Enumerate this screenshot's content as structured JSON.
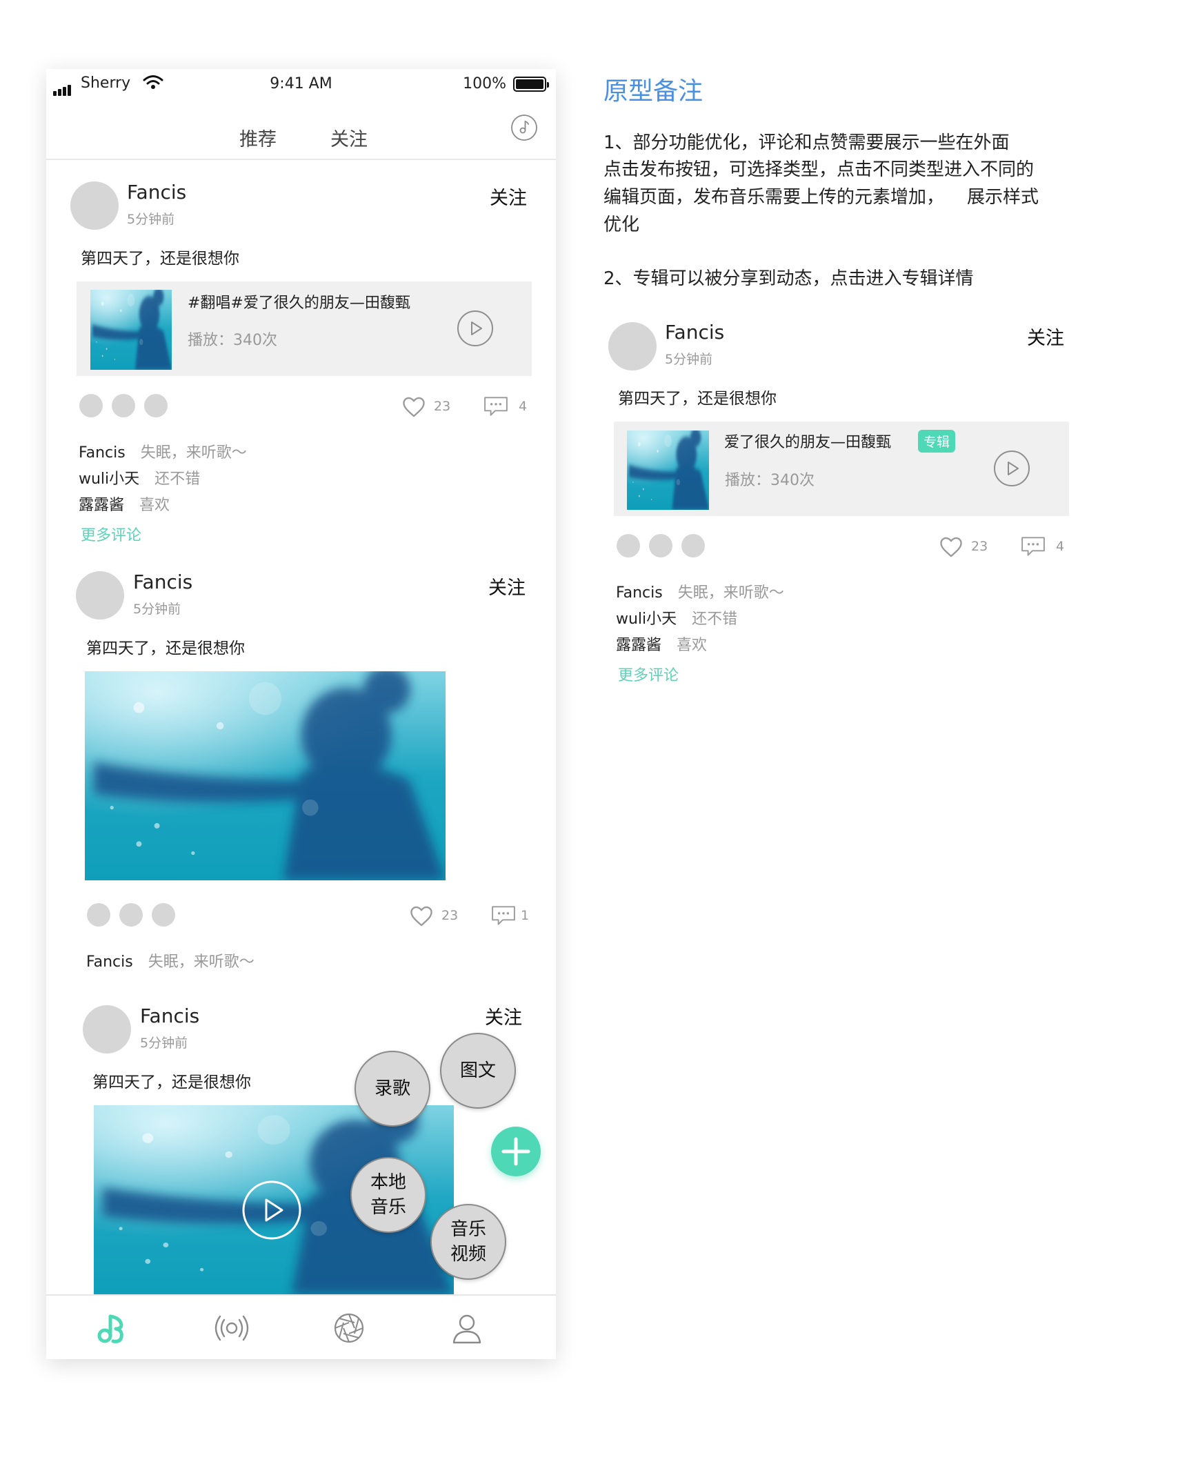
{
  "status_bar": {
    "carrier": "Sherry",
    "time": "9:41 AM",
    "battery": "100%"
  },
  "top_nav": {
    "tabs": [
      "推荐",
      "关注"
    ],
    "music_icon": "music-disc-icon"
  },
  "posts": [
    {
      "user": "Fancis",
      "time": "5分钟前",
      "follow": "关注",
      "text": "第四天了，还是很想你",
      "music": {
        "title": "#翻唱#爱了很久的朋友—田馥甄",
        "plays": "播放：340次"
      },
      "likes": "23",
      "comments_count": "4",
      "comments": [
        {
          "name": "Fancis",
          "body": "失眠，来听歌～"
        },
        {
          "name": "wuli小天",
          "body": "还不错"
        },
        {
          "name": "露露酱",
          "body": "喜欢"
        }
      ],
      "more_comments": "更多评论"
    },
    {
      "user": "Fancis",
      "time": "5分钟前",
      "follow": "关注",
      "text": "第四天了，还是很想你",
      "likes": "23",
      "comments_count": "1",
      "comments": [
        {
          "name": "Fancis",
          "body": "失眠，来听歌～"
        }
      ]
    },
    {
      "user": "Fancis",
      "time": "5分钟前",
      "follow": "关注",
      "text": "第四天了，还是很想你"
    }
  ],
  "publish_menu": {
    "options": [
      "录歌",
      "图文",
      "本地\n音乐",
      "音乐\n视频"
    ],
    "fab_icon": "plus-icon"
  },
  "tab_bar": {
    "items": [
      "music-note-icon",
      "broadcast-icon",
      "aperture-icon",
      "profile-icon"
    ],
    "active_color": "#4fd8b5"
  },
  "notes": {
    "title": "原型备注",
    "lines": [
      "1、部分功能优化，评论和点赞需要展示一些在外面",
      "点击发布按钮，可选择类型，点击不同类型进入不同的",
      "编辑页面，发布音乐需要上传的元素增加，    展示样式",
      "优化",
      "2、专辑可以被分享到动态，点击进入专辑详情"
    ],
    "example_post": {
      "user": "Fancis",
      "time": "5分钟前",
      "follow": "关注",
      "text": "第四天了，还是很想你",
      "album": {
        "title": "爱了很久的朋友—田馥甄",
        "tag": "专辑",
        "plays": "播放：340次"
      },
      "likes": "23",
      "comments_count": "4",
      "comments": [
        {
          "name": "Fancis",
          "body": "失眠，来听歌～"
        },
        {
          "name": "wuli小天",
          "body": "还不错"
        },
        {
          "name": "露露酱",
          "body": "喜欢"
        }
      ],
      "more_comments": "更多评论"
    }
  },
  "colors": {
    "accent": "#4fd8b5",
    "notes_title": "#4a90e2",
    "link": "#5fd3b8"
  }
}
